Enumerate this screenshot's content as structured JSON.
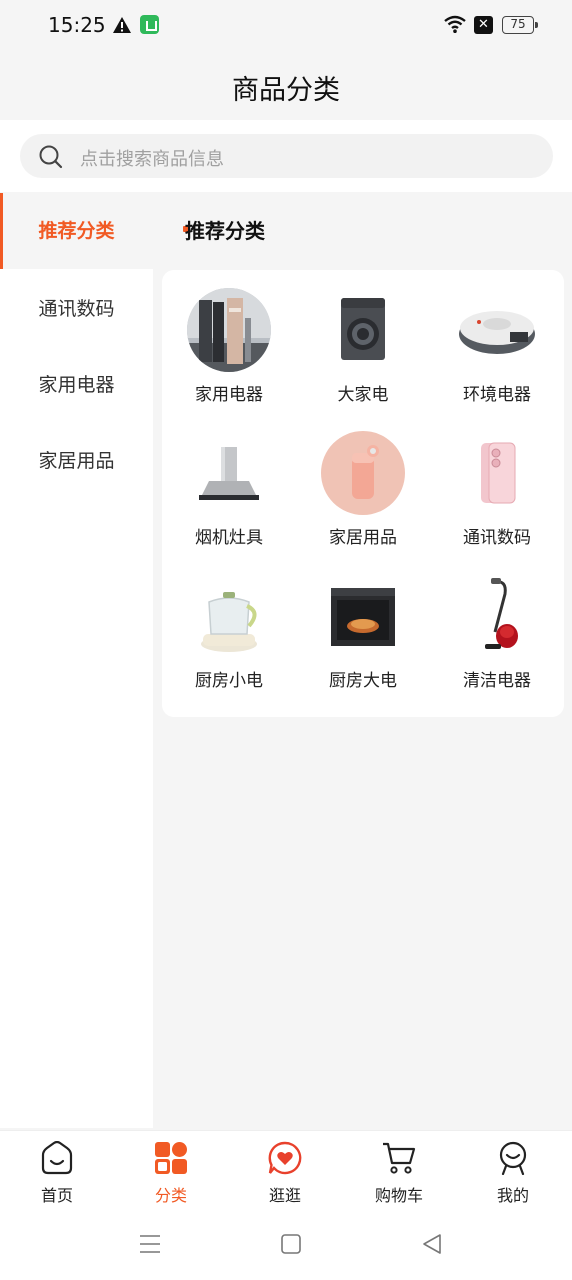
{
  "status_bar": {
    "time": "15:25",
    "battery": "75",
    "icons": [
      "warning-icon",
      "app-notification-icon",
      "wifi-icon",
      "no-sim-icon",
      "battery-icon"
    ]
  },
  "header": {
    "title": "商品分类"
  },
  "search": {
    "placeholder": "点击搜索商品信息",
    "icon": "search-icon"
  },
  "sidebar": {
    "items": [
      {
        "label": "推荐分类",
        "active": true
      },
      {
        "label": "通讯数码",
        "active": false
      },
      {
        "label": "家用电器",
        "active": false
      },
      {
        "label": "家居用品",
        "active": false
      }
    ]
  },
  "content": {
    "section_title": "推荐分类",
    "categories": [
      {
        "label": "家用电器",
        "icon": "home-appliance-image"
      },
      {
        "label": "大家电",
        "icon": "washing-machine-image"
      },
      {
        "label": "环境电器",
        "icon": "robot-vacuum-image"
      },
      {
        "label": "烟机灶具",
        "icon": "range-hood-image"
      },
      {
        "label": "家居用品",
        "icon": "thermos-cup-image"
      },
      {
        "label": "通讯数码",
        "icon": "smartphone-image"
      },
      {
        "label": "厨房小电",
        "icon": "kettle-image"
      },
      {
        "label": "厨房大电",
        "icon": "oven-image"
      },
      {
        "label": "清洁电器",
        "icon": "vacuum-cleaner-image"
      }
    ]
  },
  "tabbar": {
    "tabs": [
      {
        "label": "首页",
        "icon": "home-icon",
        "active": false
      },
      {
        "label": "分类",
        "icon": "category-icon",
        "active": true
      },
      {
        "label": "逛逛",
        "icon": "heart-chat-icon",
        "active": false
      },
      {
        "label": "购物车",
        "icon": "cart-icon",
        "active": false
      },
      {
        "label": "我的",
        "icon": "profile-icon",
        "active": false
      }
    ]
  },
  "colors": {
    "accent": "#f15a24",
    "background": "#f5f5f5"
  }
}
